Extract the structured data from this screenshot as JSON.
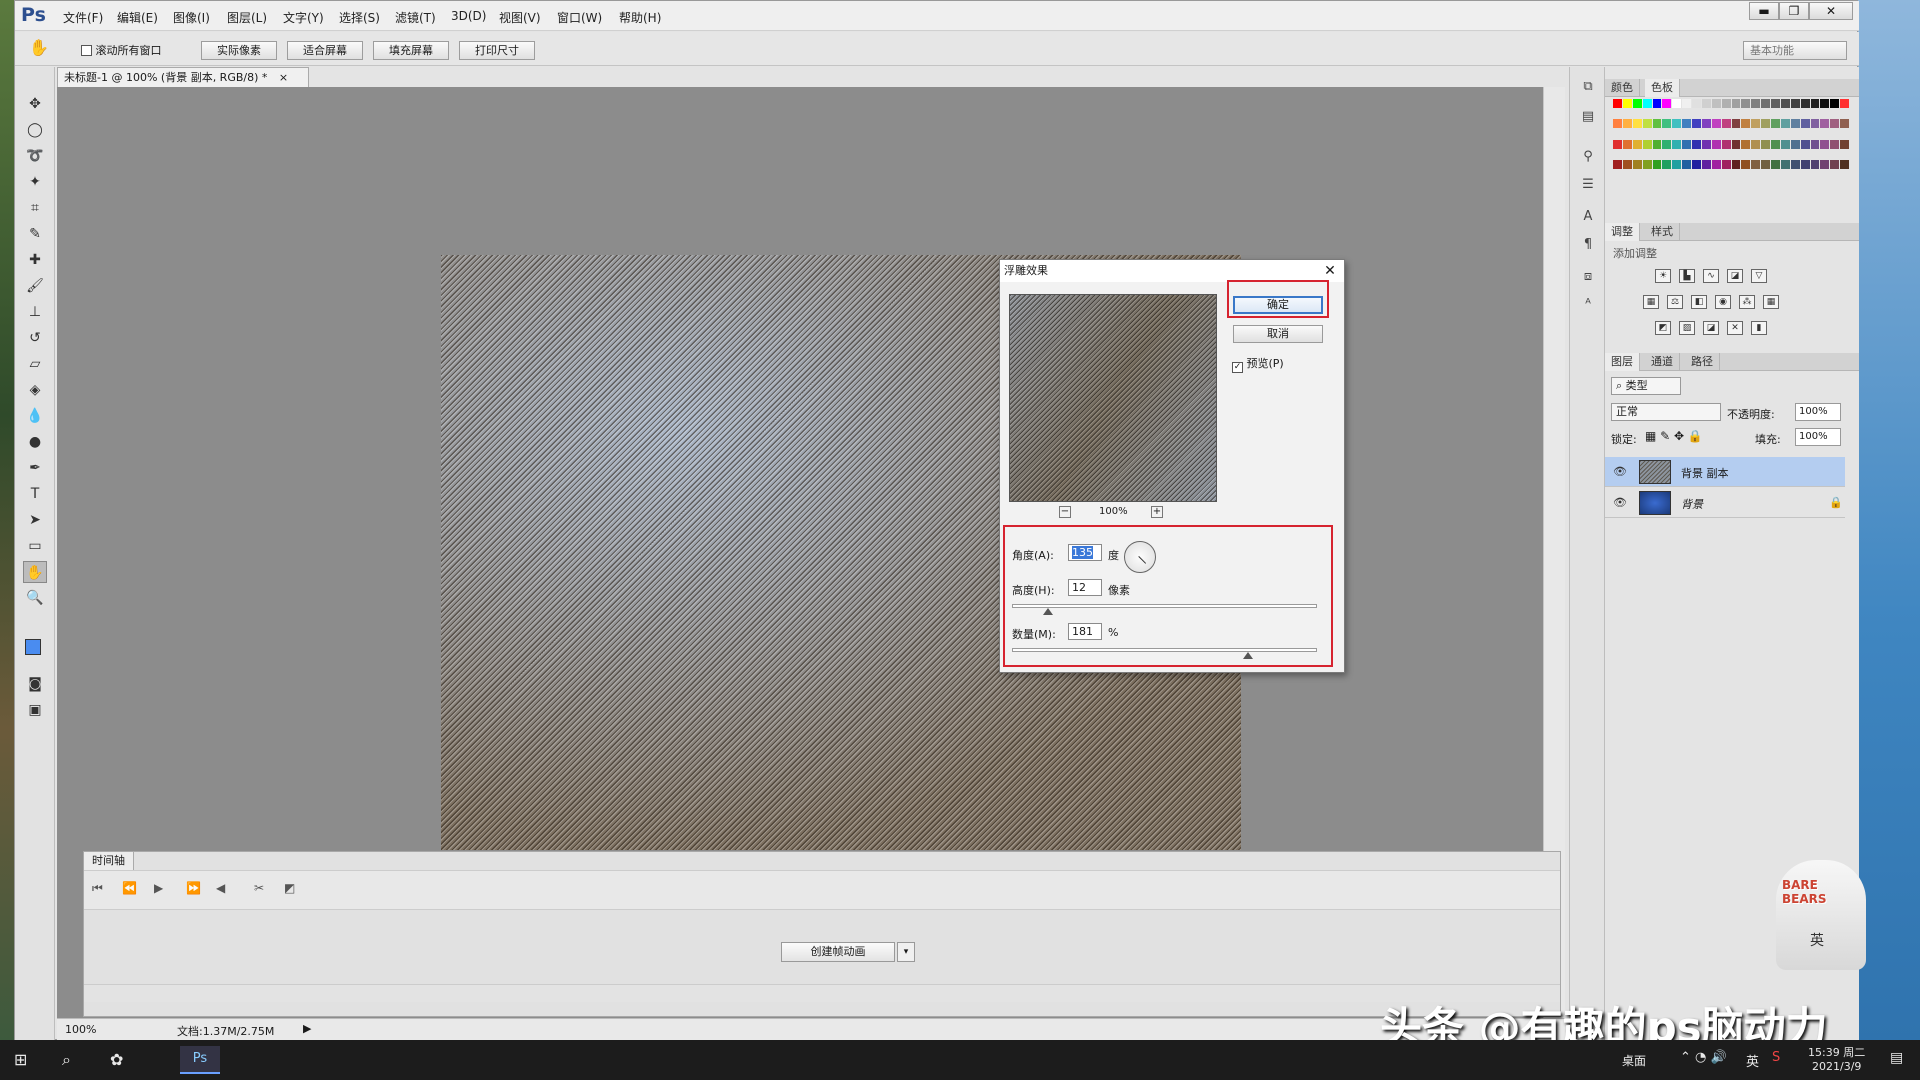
{
  "app": {
    "logo": "Ps",
    "menus": [
      "文件(F)",
      "编辑(E)",
      "图像(I)",
      "图层(L)",
      "文字(Y)",
      "选择(S)",
      "滤镜(T)",
      "3D(D)",
      "视图(V)",
      "窗口(W)",
      "帮助(H)"
    ],
    "window_controls": {
      "minimize": "▬",
      "restore": "❐",
      "close": "✕"
    }
  },
  "options_bar": {
    "scroll_all_label": "滚动所有窗口",
    "actual_pixels": "实际像素",
    "fit_screen": "适合屏幕",
    "fill_screen": "填充屏幕",
    "print_size": "打印尺寸",
    "workspace": "基本功能"
  },
  "document": {
    "tab_title": "未标题-1 @ 100% (背景 副本, RGB/8) *",
    "zoom": "100%",
    "doc_size": "文档:1.37M/2.75M"
  },
  "dialog": {
    "title": "浮雕效果",
    "ok": "确定",
    "cancel": "取消",
    "preview_label": "预览(P)",
    "preview_checked": true,
    "zoom": "100%",
    "zoom_out": "−",
    "zoom_in": "+",
    "angle_label": "角度(A):",
    "angle_value": "135",
    "angle_unit": "度",
    "height_label": "高度(H):",
    "height_value": "12",
    "height_unit": "像素",
    "amount_label": "数量(M):",
    "amount_value": "181",
    "amount_unit": "%",
    "close": "✕"
  },
  "timeline": {
    "tab": "时间轴",
    "create_button": "创建帧动画",
    "dropdown": "▾"
  },
  "panels": {
    "color_tab": "颜色",
    "swatches_tab": "色板",
    "adjust_tab": "调整",
    "styles_tab": "样式",
    "add_adjust": "添加调整",
    "layers_tab": "图层",
    "channels_tab": "通道",
    "paths_tab": "路径",
    "filter_kind": "类型",
    "blend_mode": "正常",
    "opacity_label": "不透明度:",
    "opacity_value": "100%",
    "lock_label": "锁定:",
    "fill_label": "填充:",
    "fill_value": "100%",
    "layers": [
      {
        "name": "背景 副本",
        "selected": true
      },
      {
        "name": "背景",
        "locked": true
      }
    ],
    "swatch_colors": [
      "#ff0000",
      "#ffff00",
      "#00ff00",
      "#00ffff",
      "#0000ff",
      "#ff00ff",
      "#ffffff",
      "#f0f0f0",
      "#e0e0e0",
      "#d0d0d0",
      "#c0c0c0",
      "#b0b0b0",
      "#a0a0a0",
      "#909090",
      "#808080",
      "#707070",
      "#606060",
      "#505050",
      "#404040",
      "#303030",
      "#202020",
      "#101010",
      "#000000",
      "#ff3030",
      "#ff8040",
      "#ffb040",
      "#ffe040",
      "#c0e040",
      "#60c040",
      "#40c080",
      "#40c0c0",
      "#4080c0",
      "#4040c0",
      "#8040c0",
      "#c040c0",
      "#c04080",
      "#804040",
      "#c08040",
      "#c0a060",
      "#a0a060",
      "#60a060",
      "#60a0a0",
      "#6080a0",
      "#6060a0",
      "#8060a0",
      "#a060a0",
      "#a06080",
      "#906050",
      "#e03030",
      "#e07030",
      "#e0b030",
      "#b0d030",
      "#50b030",
      "#30b070",
      "#30b0b0",
      "#3070b0",
      "#3030b0",
      "#7030b0",
      "#b030b0",
      "#b03070",
      "#703030",
      "#b07030",
      "#b09050",
      "#909050",
      "#509050",
      "#509090",
      "#507090",
      "#505090",
      "#705090",
      "#905090",
      "#905070",
      "#704030",
      "#a02020",
      "#a05020",
      "#a08020",
      "#80a020",
      "#30a020",
      "#20a060",
      "#20a0a0",
      "#2060a0",
      "#2020a0",
      "#6020a0",
      "#a020a0",
      "#a02060",
      "#602020",
      "#905020",
      "#806040",
      "#706040",
      "#407040",
      "#407070",
      "#405070",
      "#404070",
      "#504070",
      "#704070",
      "#704050",
      "#503020"
    ]
  },
  "taskbar": {
    "desktop": "桌面",
    "ime": "英",
    "time": "15:39 周二",
    "date": "2021/3/9"
  },
  "watermark": "头条 @有趣的ps脑动力",
  "bears_text": "BARE BEARS"
}
